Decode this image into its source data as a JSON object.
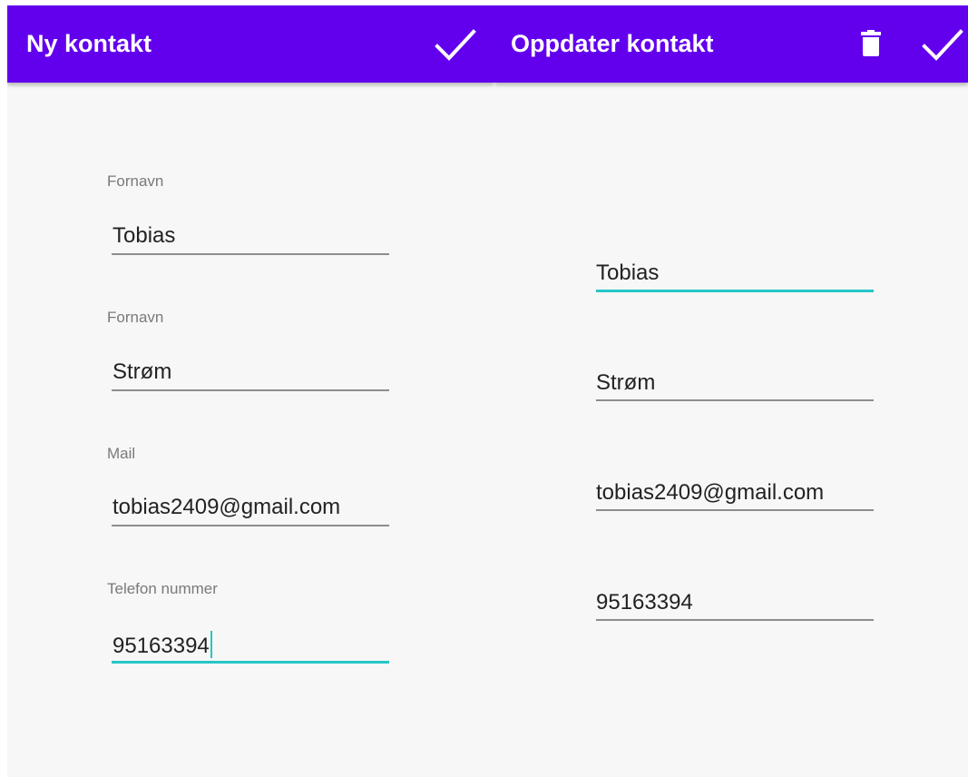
{
  "new_contact": {
    "title": "Ny kontakt",
    "save_icon": "check-icon",
    "fields": [
      {
        "label": "Fornavn",
        "value": "Tobias"
      },
      {
        "label": "Fornavn",
        "value": "Strøm"
      },
      {
        "label": "Mail",
        "value": "tobias2409@gmail.com"
      },
      {
        "label": "Telefon nummer",
        "value": "95163394",
        "focused": true
      }
    ]
  },
  "update_contact": {
    "title": "Oppdater kontakt",
    "delete_icon": "trash-icon",
    "save_icon": "check-icon",
    "fields": [
      {
        "value": "Tobias",
        "focused": true
      },
      {
        "value": "Strøm"
      },
      {
        "value": "tobias2409@gmail.com"
      },
      {
        "value": "95163394"
      }
    ]
  },
  "colors": {
    "appbar": "#6200ee",
    "accent": "#26c6c6",
    "background": "#f7f7f7",
    "underline": "#8d8d8d"
  }
}
